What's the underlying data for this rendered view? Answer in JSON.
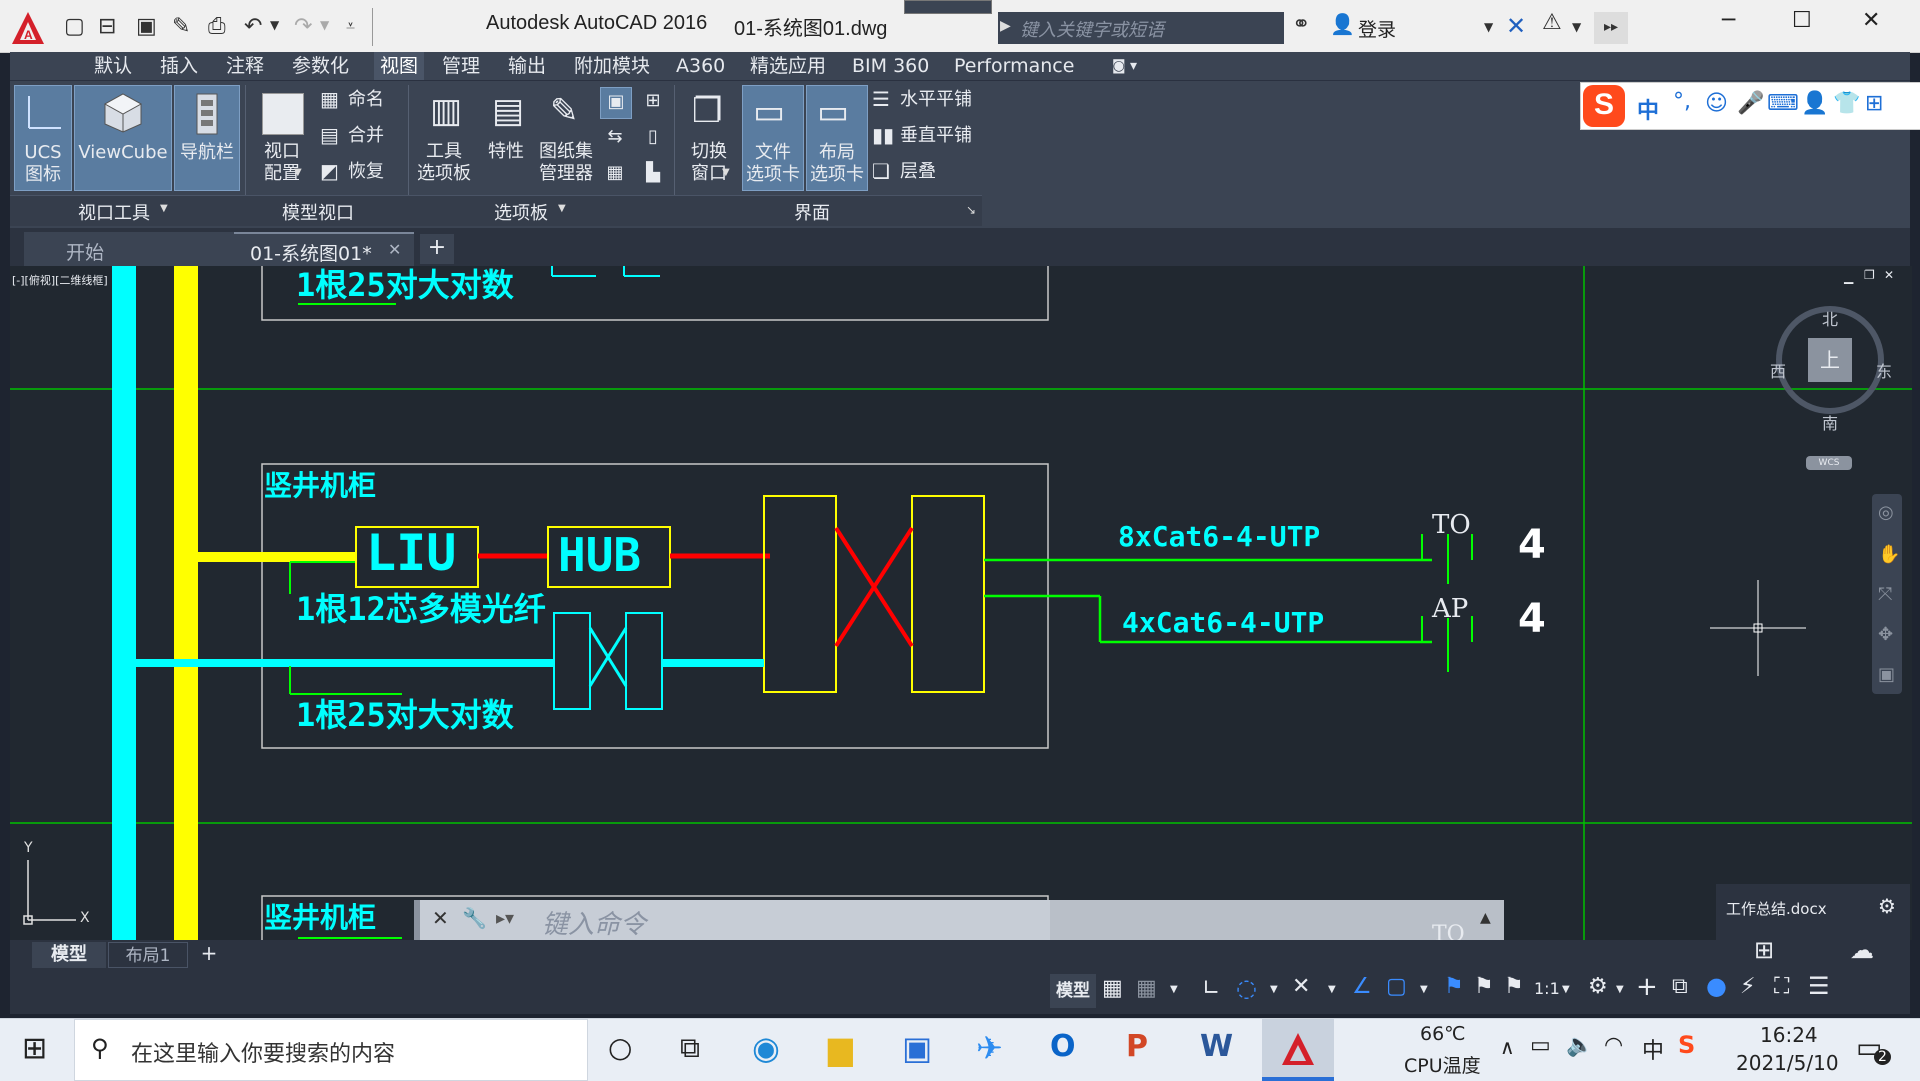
{
  "title_bar": {
    "app_title": "Autodesk AutoCAD 2016",
    "file_name": "01-系统图01.dwg",
    "search_placeholder": "键入关键字或短语",
    "login_label": "登录"
  },
  "menu": {
    "items": [
      "默认",
      "插入",
      "注释",
      "参数化",
      "视图",
      "管理",
      "输出",
      "附加模块",
      "A360",
      "精选应用",
      "BIM 360",
      "Performance"
    ],
    "active": "视图"
  },
  "ribbon": {
    "ucs_label_1": "UCS",
    "ucs_label_2": "图标",
    "viewcube_label": "ViewCube",
    "navbar_label": "导航栏",
    "viewport_config_1": "视口",
    "viewport_config_2": "配置",
    "named_label": "命名",
    "join_label": "合并",
    "restore_label": "恢复",
    "tool_palette_1": "工具",
    "tool_palette_2": "选项板",
    "properties_label": "特性",
    "sheetset_1": "图纸集",
    "sheetset_2": "管理器",
    "switch_window_1": "切换",
    "switch_window_2": "窗口",
    "file_tabs_1": "文件",
    "file_tabs_2": "选项卡",
    "layout_tabs_1": "布局",
    "layout_tabs_2": "选项卡",
    "tile_horizontal": "水平平铺",
    "tile_vertical": "垂直平铺",
    "cascade": "层叠",
    "panel_viewport_tools": "视口工具",
    "panel_model_viewports": "模型视口",
    "panel_palettes": "选项板",
    "panel_interface": "界面"
  },
  "file_tabs": {
    "start": "开始",
    "current": "01-系统图01*"
  },
  "viewport": {
    "label": "[-][俯视][二维线框]",
    "compass_n": "北",
    "compass_s": "南",
    "compass_e": "东",
    "compass_w": "西",
    "compass_top": "上",
    "wcs": "WCS",
    "axis_x": "X",
    "axis_y": "Y"
  },
  "drawing": {
    "top_cable_label": "1根25对大对数",
    "cabinet_label": "竖井机柜",
    "liu": "LIU",
    "hub": "HUB",
    "fiber_label": "1根12芯多模光纤",
    "cable_label": "1根25对大对数",
    "cat6_8": "8xCat6-4-UTP",
    "cat6_4": "4xCat6-4-UTP",
    "to": "TO",
    "ap": "AP",
    "count_to": "4",
    "count_ap": "4",
    "bottom_cabinet_label": "竖井机柜",
    "bottom_to": "TO"
  },
  "command_line": {
    "placeholder": "键入命令"
  },
  "layout_tabs": {
    "model": "模型",
    "layout1": "布局1"
  },
  "status_bar": {
    "model": "模型",
    "scale": "1:1"
  },
  "notification": {
    "file": "工作总结.docx"
  },
  "taskbar": {
    "search_placeholder": "在这里输入你要搜索的内容",
    "temp": "66℃",
    "temp_label": "CPU温度",
    "ime": "中",
    "time": "16:24",
    "date": "2021/5/10",
    "notif_count": "2"
  },
  "ime_toolbar": {
    "lang": "中",
    "punct": "°,"
  },
  "colors": {
    "cyan": "#00ffff",
    "yellow": "#ffff00",
    "red": "#ff0000",
    "green": "#00ff00",
    "white": "#ffffff",
    "canvas_bg": "#212830"
  }
}
